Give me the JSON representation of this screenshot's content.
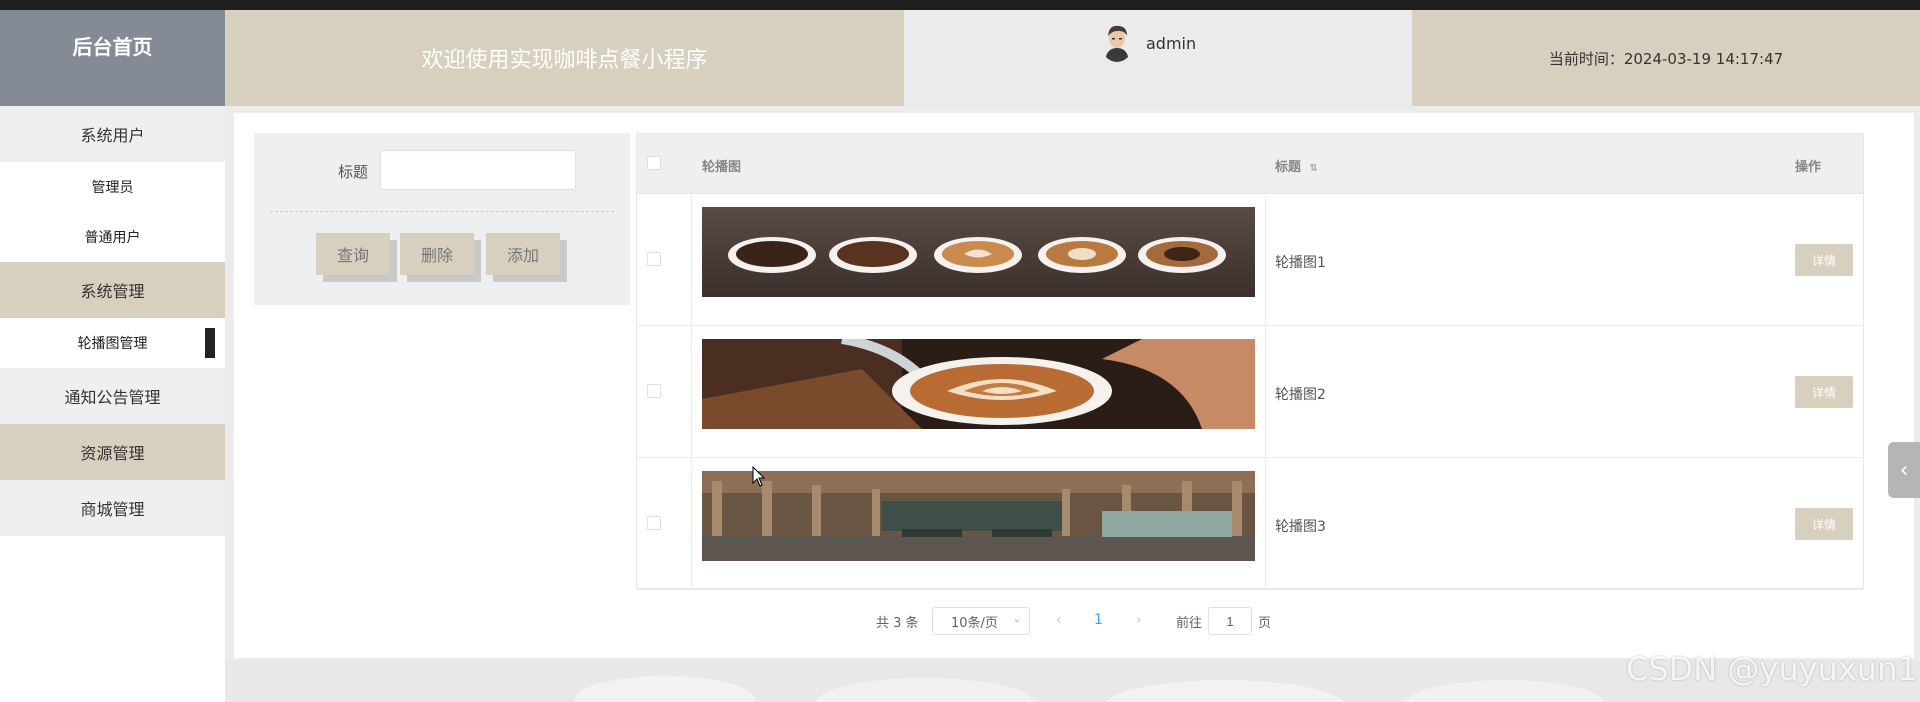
{
  "header": {
    "home": "后台首页",
    "title": "欢迎使用实现咖啡点餐小程序",
    "username": "admin",
    "time_text": "当前时间：2024-03-19 14:17:47"
  },
  "sidebar": {
    "items": [
      {
        "label": "系统用户"
      },
      {
        "label": "管理员"
      },
      {
        "label": "普通用户"
      },
      {
        "label": "系统管理"
      },
      {
        "label": "轮播图管理"
      },
      {
        "label": "通知公告管理"
      },
      {
        "label": "资源管理"
      },
      {
        "label": "商城管理"
      }
    ]
  },
  "search": {
    "label": "标题",
    "value": "",
    "placeholder": "",
    "query": "查询",
    "delete": "删除",
    "add": "添加"
  },
  "table": {
    "headers": {
      "image": "轮播图",
      "title": "标题",
      "action": "操作"
    },
    "rows": [
      {
        "title": "轮播图1",
        "action": "详情",
        "image": "coffee-cups-row"
      },
      {
        "title": "轮播图2",
        "action": "详情",
        "image": "latte-art"
      },
      {
        "title": "轮播图3",
        "action": "详情",
        "image": "cafe-interior"
      }
    ]
  },
  "pagination": {
    "total": "共 3 条",
    "page_size": "10条/页",
    "current": "1",
    "goto_prefix": "前往",
    "goto_value": "1",
    "goto_suffix": "页"
  },
  "watermark": "CSDN @yuyuxun1",
  "colors": {
    "accent": "#d8d0bf",
    "home_bg": "#858b94",
    "sidebar_gray": "#eeeff1",
    "pager_active": "#409eff"
  }
}
